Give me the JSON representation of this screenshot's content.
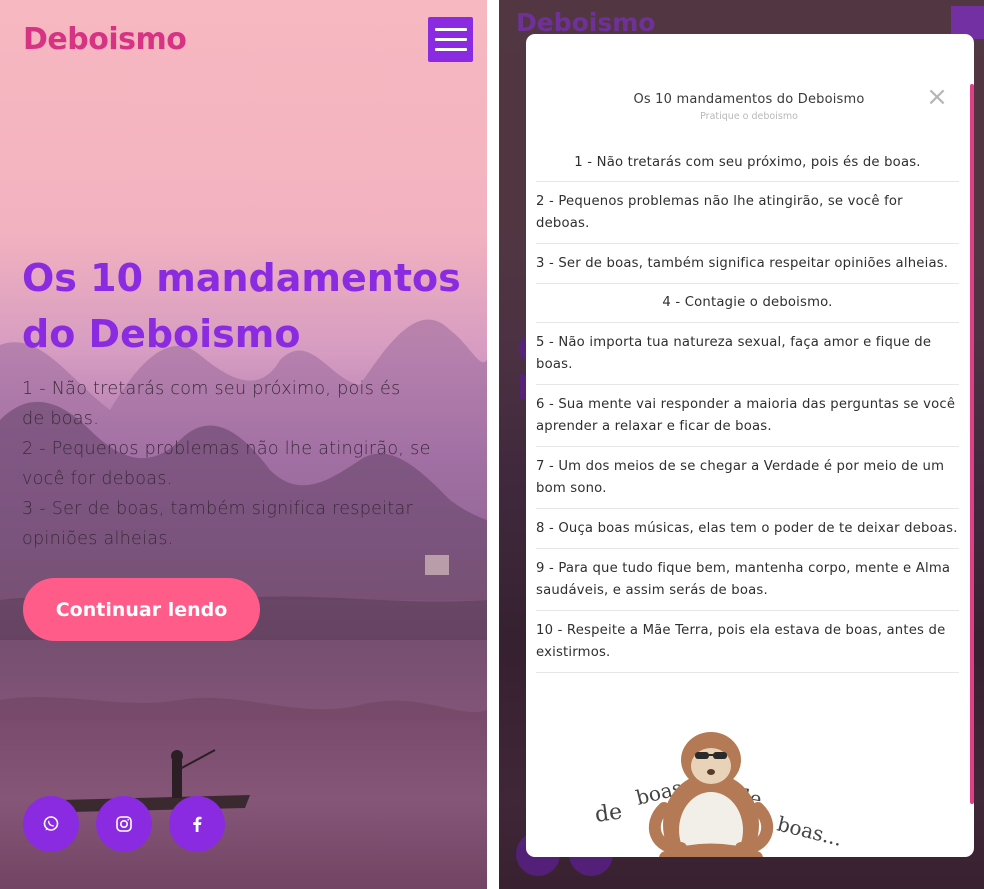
{
  "left": {
    "brand": "Deboismo",
    "menu_icon": "hamburger-menu-icon",
    "hero": {
      "title_line1": "Os 10 mandamentos",
      "title_line2": "do Deboismo",
      "lines": [
        "1 - Não tretarás com seu próximo, pois és",
        "de boas.",
        "2 - Pequenos problemas não lhe atingirão, se",
        "você for deboas.",
        "3 - Ser de boas, também significa respeitar",
        "opiniões alheias."
      ],
      "cta_label": "Continuar lendo"
    },
    "social_icons": [
      "whatsapp-icon",
      "instagram-icon",
      "facebook-icon"
    ],
    "colors": {
      "brand": "#d63384",
      "accent": "#8a2be2",
      "cta": "#ff5c8a"
    }
  },
  "right": {
    "background_brand": "Deboismo",
    "modal": {
      "title": "Os 10 mandamentos do Deboismo",
      "subtitle": "Pratique o deboismo",
      "close_icon": "close-icon",
      "commandments": [
        {
          "text": "1 - Não tretarás com seu próximo, pois és de boas.",
          "align": "center"
        },
        {
          "text": "2 - Pequenos problemas não lhe atingirão, se você for deboas.",
          "align": "left"
        },
        {
          "text": "3 - Ser de boas, também significa respeitar opiniões alheias.",
          "align": "left"
        },
        {
          "text": "4 - Contagie o deboismo.",
          "align": "center"
        },
        {
          "text": "5 - Não importa tua natureza sexual, faça amor e fique de boas.",
          "align": "left"
        },
        {
          "text": "6 - Sua mente vai responder a maioria das perguntas se você aprender a relaxar e ficar de boas.",
          "align": "left"
        },
        {
          "text": "7 - Um dos meios de se chegar a Verdade é por meio de um bom sono.",
          "align": "left"
        },
        {
          "text": "8 - Ouça boas músicas, elas tem o poder de te deixar deboas.",
          "align": "left"
        },
        {
          "text": "9 - Para que tudo fique bem, mantenha corpo, mente e Alma saudáveis, e assim serás de boas.",
          "align": "left"
        },
        {
          "text": "10 - Respeite a Mãe Terra, pois ela estava de boas, antes de existirmos.",
          "align": "left"
        }
      ],
      "illustration_text": [
        "de",
        "boas...",
        "de",
        "boas..."
      ]
    }
  }
}
